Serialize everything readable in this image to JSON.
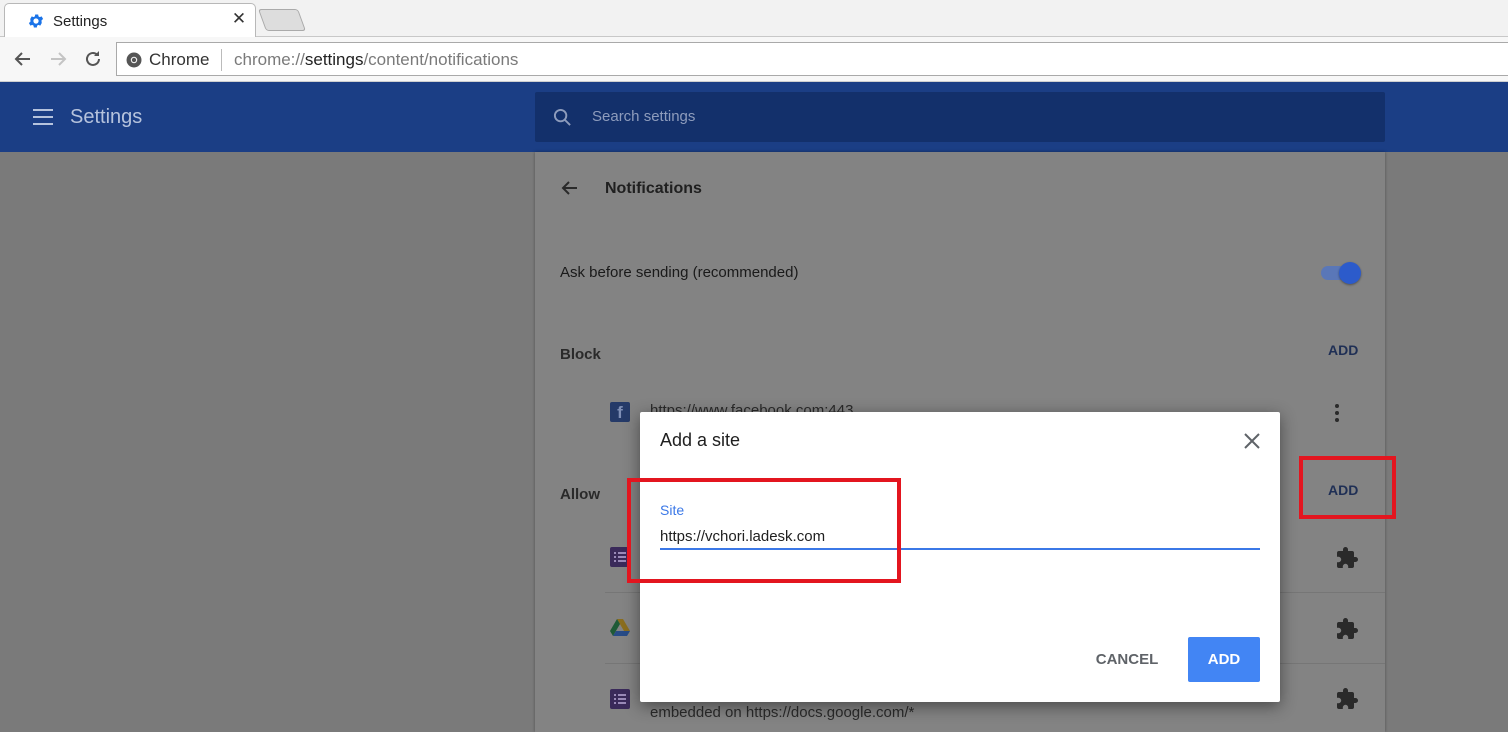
{
  "browser": {
    "tab_title": "Settings",
    "omnibox": {
      "chip": "Chrome",
      "url_scheme": "chrome://",
      "url_host": "settings",
      "url_path": "/content/notifications"
    }
  },
  "header": {
    "title": "Settings",
    "search_placeholder": "Search settings"
  },
  "page": {
    "title": "Notifications",
    "ask_label": "Ask before sending (recommended)",
    "ask_enabled": true,
    "block": {
      "heading": "Block",
      "add_label": "ADD",
      "site": "https://www.facebook.com:443"
    },
    "allow": {
      "heading": "Allow",
      "add_label": "ADD",
      "last_row_text": "embedded on https://docs.google.com/*"
    }
  },
  "dialog": {
    "title": "Add a site",
    "field_label": "Site",
    "field_value": "https://vchori.ladesk.com",
    "cancel_label": "CANCEL",
    "add_label": "ADD"
  },
  "colors": {
    "header_bg": "#1b3e85",
    "accent": "#4285f4",
    "highlight": "#e3151f"
  }
}
